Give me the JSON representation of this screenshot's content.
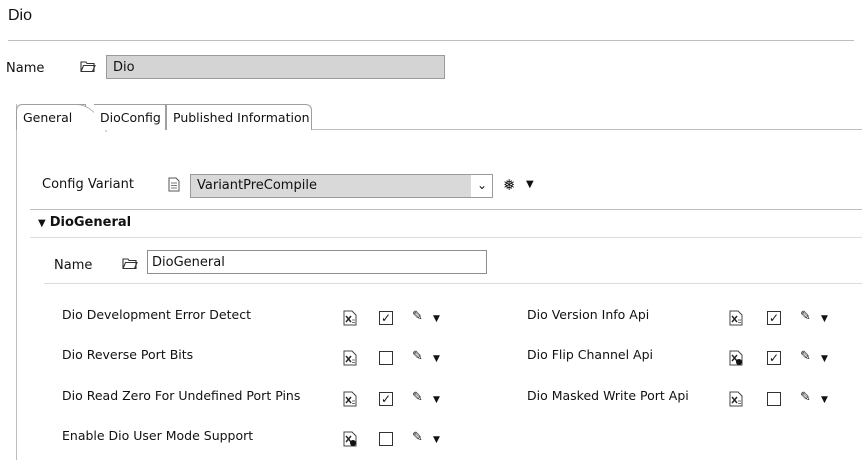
{
  "page": {
    "title": "Dio"
  },
  "module": {
    "name_label": "Name",
    "name_value": "Dio"
  },
  "tabs": [
    {
      "label": "General"
    },
    {
      "label": "DioConfig"
    },
    {
      "label": "Published Information"
    }
  ],
  "config_variant": {
    "label": "Config Variant",
    "value": "VariantPreCompile"
  },
  "section": {
    "title": "DioGeneral",
    "name_label": "Name",
    "name_value": "DioGeneral"
  },
  "params": [
    {
      "label": "Dio Development Error Detect",
      "checked": true,
      "icon": "xml-default-icon"
    },
    {
      "label": "Dio Reverse Port Bits",
      "checked": false,
      "icon": "xml-default-icon"
    },
    {
      "label": "Dio Read Zero For Undefined Port Pins",
      "checked": true,
      "icon": "xml-default-icon"
    },
    {
      "label": "Enable Dio User Mode Support",
      "checked": false,
      "icon": "xml-derived-icon"
    },
    {
      "label": "Dio Version Info Api",
      "checked": true,
      "icon": "xml-default-icon"
    },
    {
      "label": "Dio Flip Channel Api",
      "checked": true,
      "icon": "xml-derived-icon"
    },
    {
      "label": "Dio Masked Write Port Api",
      "checked": false,
      "icon": "xml-default-icon"
    }
  ]
}
